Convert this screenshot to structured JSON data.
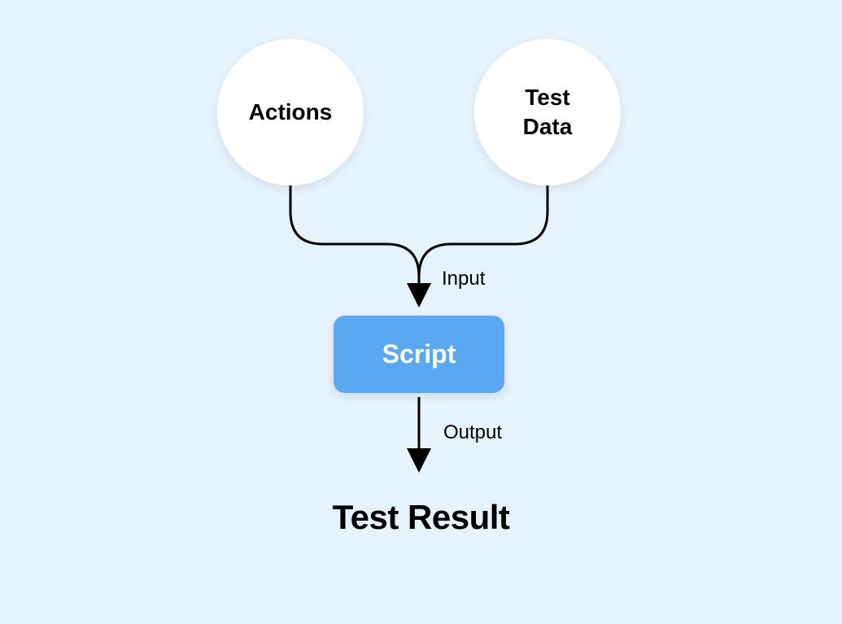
{
  "nodes": {
    "actions": {
      "label": "Actions"
    },
    "testdata": {
      "label": "Test\nData"
    },
    "script": {
      "label": "Script"
    },
    "result": {
      "label": "Test Result"
    }
  },
  "flows": {
    "input": {
      "label": "Input"
    },
    "output": {
      "label": "Output"
    }
  },
  "diagram_structure": {
    "type": "flowchart",
    "description": "Actions and Test Data merge as Input into Script, which Outputs Test Result",
    "edges": [
      {
        "from": "actions",
        "to": "script",
        "label": "Input"
      },
      {
        "from": "testdata",
        "to": "script",
        "label": "Input"
      },
      {
        "from": "script",
        "to": "result",
        "label": "Output"
      }
    ]
  }
}
